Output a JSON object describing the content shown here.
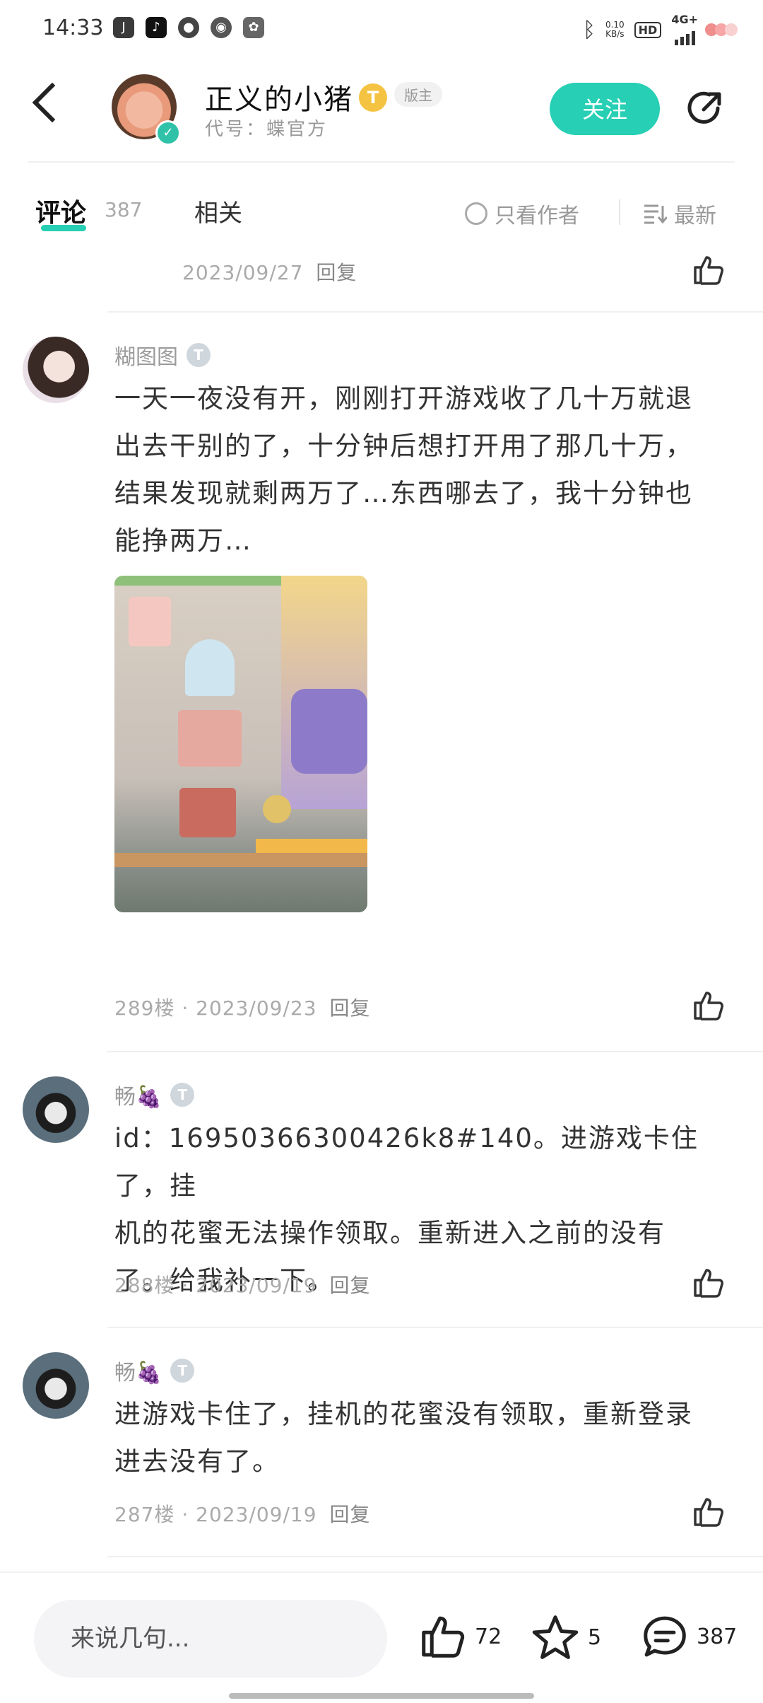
{
  "status_bar": {
    "time": "14:33",
    "net_speed_top": "0.10",
    "net_speed_bottom": "KB/s",
    "hd": "HD",
    "network": "4G+"
  },
  "header": {
    "name": "正义的小猪",
    "level_badge": "T",
    "role_badge": "版主",
    "code": "代号：蝶官方",
    "follow_label": "关注"
  },
  "tabs": {
    "comments_label": "评论",
    "comments_count": "387",
    "related_label": "相关",
    "author_only_label": "只看作者",
    "sort_label": "最新"
  },
  "comments": {
    "c0": {
      "date": "2023/09/27",
      "reply": "回复"
    },
    "c1": {
      "user": "糊图图",
      "level": "T",
      "lines": [
        "一天一夜没有开，刚刚打开游戏收了几十万就退",
        "出去干别的了，十分钟后想打开用了那几十万，",
        "结果发现就剩两万了…东西哪去了，我十分钟也",
        "能挣两万…"
      ],
      "floor": "289楼",
      "date": "2023/09/23",
      "reply": "回复"
    },
    "c2": {
      "user": "畅🍇",
      "level": "T",
      "lines": [
        "id：16950366300426k8#140。进游戏卡住了，挂",
        "机的花蜜无法操作领取。重新进入之前的没有",
        "了。给我补一下。"
      ],
      "floor": "288楼",
      "date": "2023/09/19",
      "reply": "回复"
    },
    "c3": {
      "user": "畅🍇",
      "level": "T",
      "lines": [
        "进游戏卡住了，挂机的花蜜没有领取，重新登录",
        "进去没有了。"
      ],
      "floor": "287楼",
      "date": "2023/09/19",
      "reply": "回复"
    }
  },
  "bottom_bar": {
    "input_placeholder": "来说几句...",
    "likes": "72",
    "favorites": "5",
    "comments": "387"
  },
  "colors": {
    "accent": "#27cfb4",
    "level_gold": "#f5c342"
  }
}
